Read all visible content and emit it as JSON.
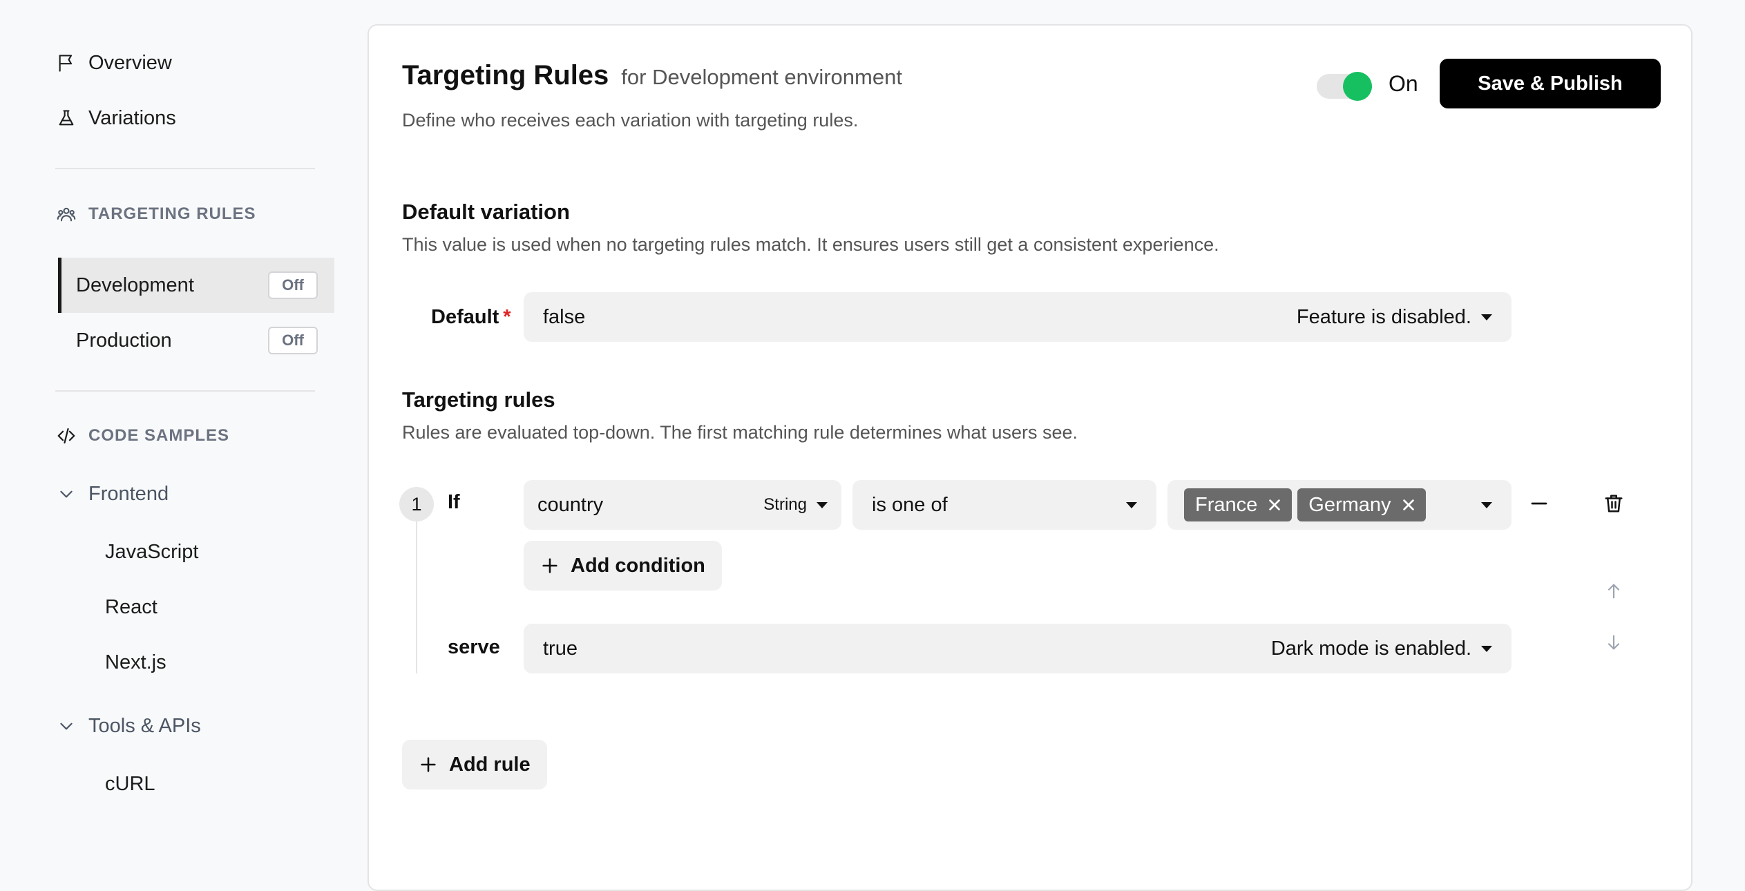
{
  "sidebar": {
    "nav": [
      {
        "label": "Overview",
        "icon": "flag-icon"
      },
      {
        "label": "Variations",
        "icon": "flask-icon"
      }
    ],
    "targeting_section": "TARGETING RULES",
    "environments": [
      {
        "label": "Development",
        "status": "Off",
        "active": true
      },
      {
        "label": "Production",
        "status": "Off",
        "active": false
      }
    ],
    "code_section": "CODE SAMPLES",
    "groups": [
      {
        "label": "Frontend",
        "items": [
          "JavaScript",
          "React",
          "Next.js"
        ]
      },
      {
        "label": "Tools & APIs",
        "items": [
          "cURL"
        ]
      }
    ]
  },
  "header": {
    "title": "Targeting Rules",
    "subtitle": "for Development environment",
    "description": "Define who receives each variation with targeting rules.",
    "toggle_label": "On",
    "toggle_on": true,
    "toggle_color": "#16c060",
    "publish_label": "Save & Publish"
  },
  "default_variation": {
    "heading": "Default variation",
    "description": "This value is used when no targeting rules match. It ensures users still get a consistent experience.",
    "field_label": "Default",
    "required_mark": "*",
    "value": "false",
    "value_desc": "Feature is disabled."
  },
  "targeting": {
    "heading": "Targeting rules",
    "description": "Rules are evaluated top-down. The first matching rule determines what users see.",
    "rules": [
      {
        "number": "1",
        "if_label": "If",
        "attribute": "country",
        "attribute_type": "String",
        "operator": "is one of",
        "values": [
          "France",
          "Germany"
        ],
        "add_condition_label": "Add condition",
        "serve_label": "serve",
        "serve_value": "true",
        "serve_desc": "Dark mode is enabled."
      }
    ],
    "add_rule_label": "Add rule"
  }
}
